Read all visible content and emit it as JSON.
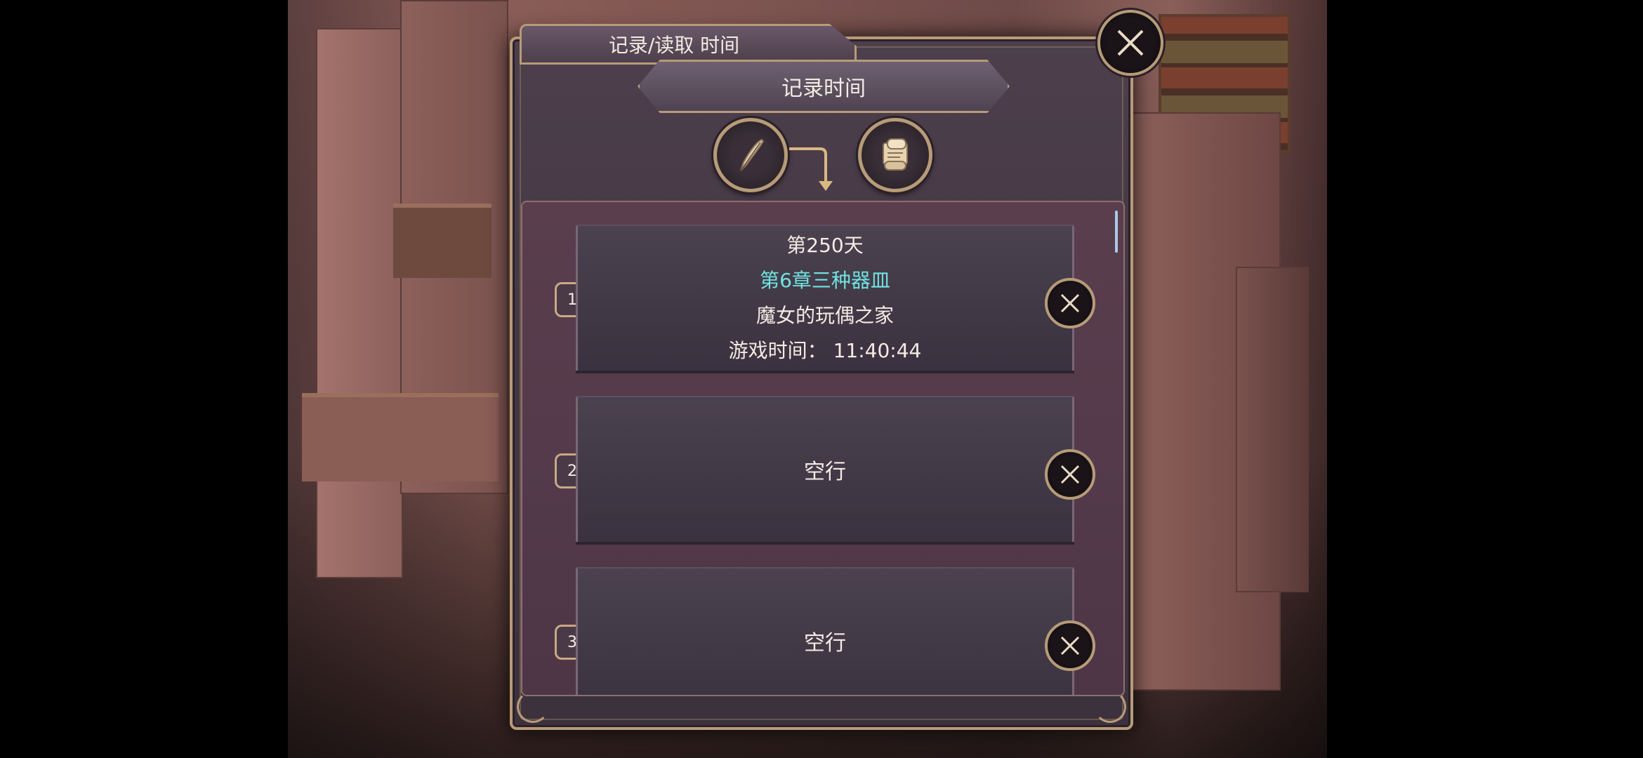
{
  "dialog": {
    "tab_title": "记录/读取 时间",
    "subtitle": "记录时间",
    "close_icon": "close-x-icon",
    "mode_icons": [
      "quill-pen-icon",
      "scroll-icon"
    ]
  },
  "slots": [
    {
      "number": "1",
      "day": "第250天",
      "chapter": "第6章三种器皿",
      "location": "魔女的玩偶之家",
      "play_time": "游戏时间： 11:40:44"
    },
    {
      "number": "2",
      "empty_label": "空行"
    },
    {
      "number": "3",
      "empty_label": "空行"
    }
  ],
  "colors": {
    "panel_border": "#b79b78",
    "chapter_text": "#6fe3e0",
    "text": "#f3ece3"
  }
}
